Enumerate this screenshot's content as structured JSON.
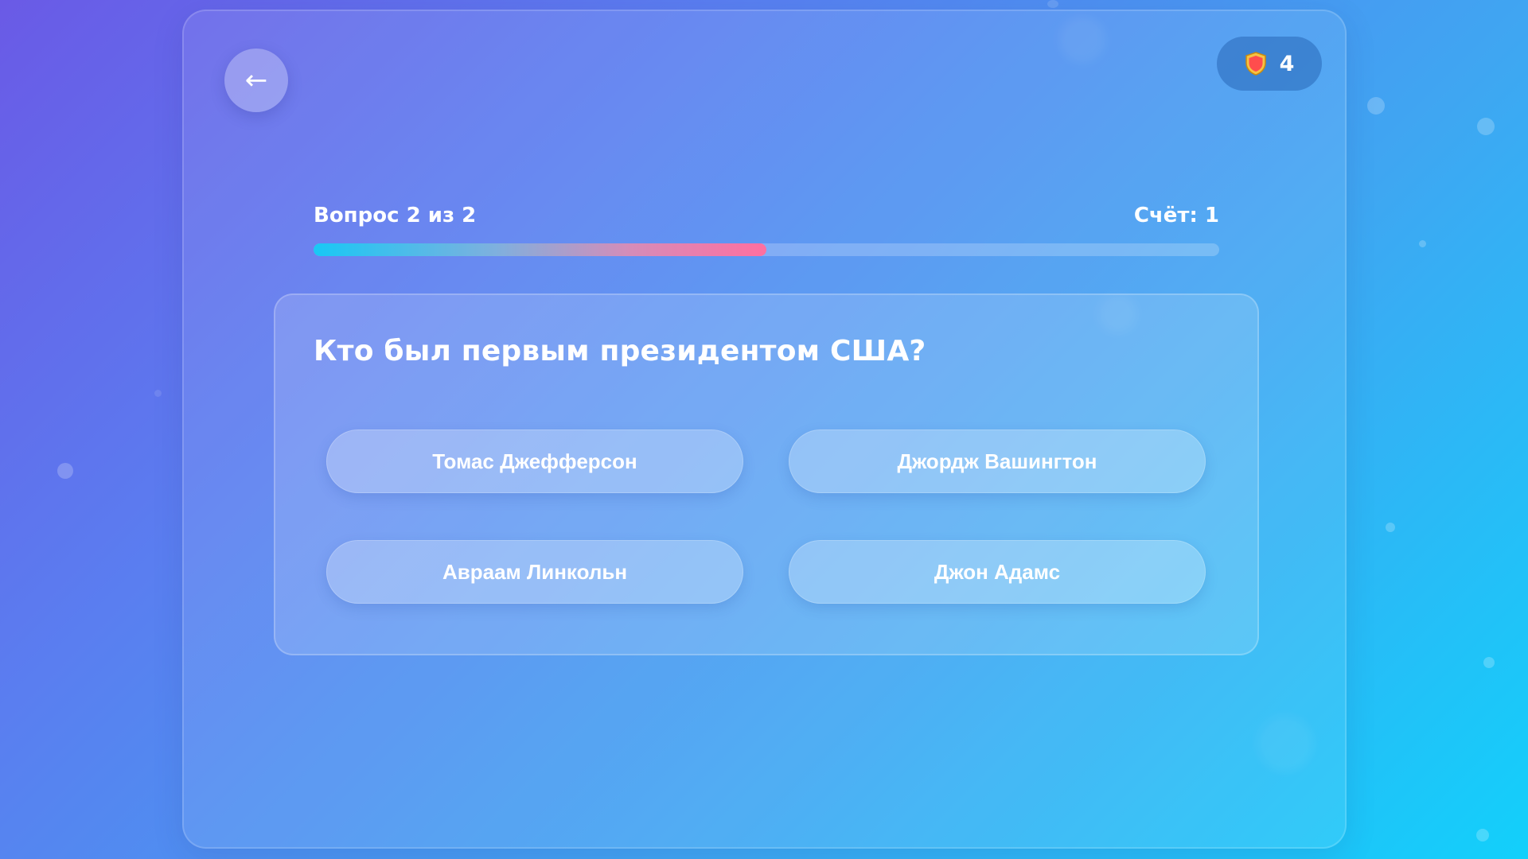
{
  "header": {
    "back_icon": "←",
    "lives_icon": "shield-heart-icon",
    "lives_count": "4"
  },
  "progress": {
    "question_label": "Вопрос 2 из 2",
    "score_label": "Счёт: 1",
    "fill_percent": 50
  },
  "question": {
    "text": "Кто был первым президентом США?",
    "answers": [
      "Томас Джефферсон",
      "Джордж Вашингтон",
      "Авраам Линкольн",
      "Джон Адамс"
    ]
  },
  "colors": {
    "background_start": "#6a5ae6",
    "background_end": "#12d0fb",
    "progress_start": "#18c8f5",
    "progress_end": "#ff6fa0",
    "lives_icon_color": "#ff4d4d"
  }
}
